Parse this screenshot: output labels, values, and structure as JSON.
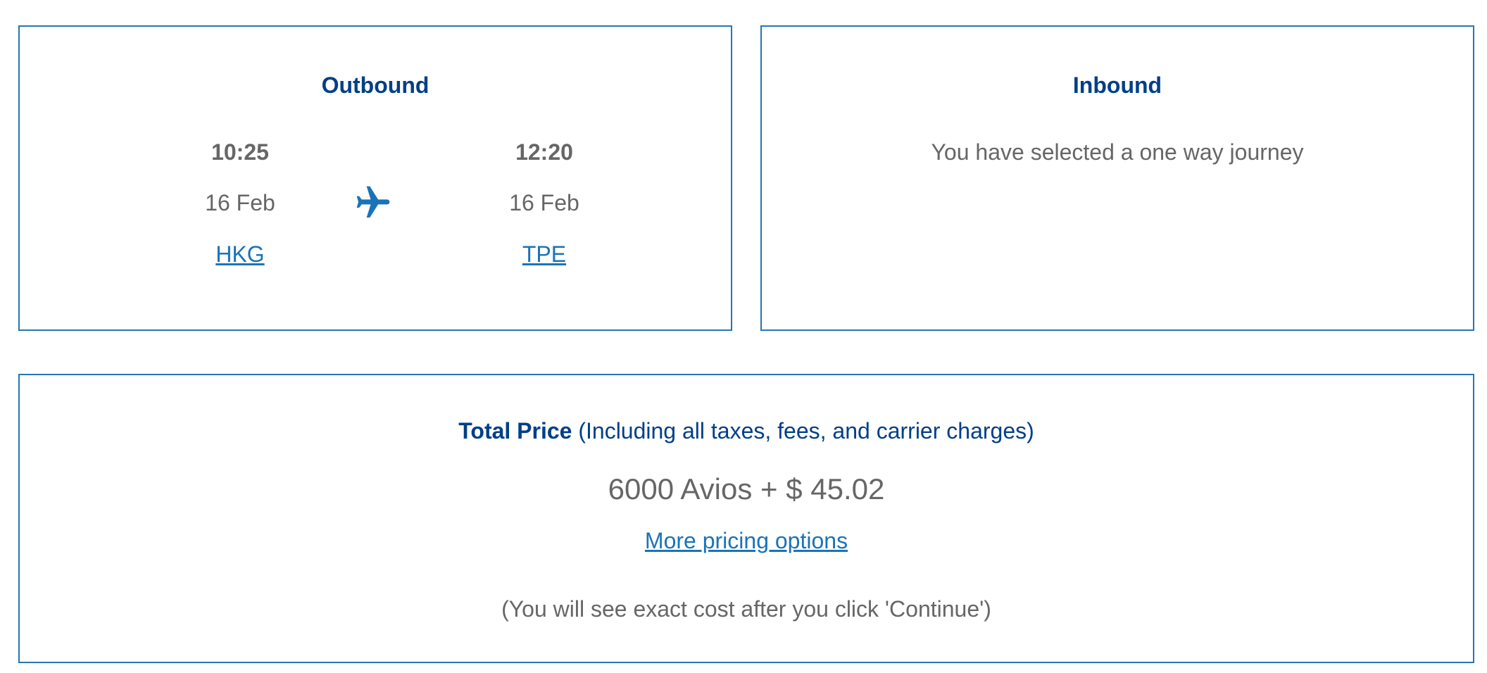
{
  "outbound": {
    "title": "Outbound",
    "departure": {
      "time": "10:25",
      "date": "16 Feb",
      "airport": "HKG"
    },
    "arrival": {
      "time": "12:20",
      "date": "16 Feb",
      "airport": "TPE"
    },
    "icon": "airplane-icon",
    "accent_color": "#1a73b8"
  },
  "inbound": {
    "title": "Inbound",
    "message": "You have selected a one way journey"
  },
  "price": {
    "label_strong": "Total Price",
    "label_detail": " (Including all taxes, fees, and carrier charges)",
    "value": "6000 Avios + $ 45.02",
    "more_options_link": "More pricing options",
    "note": "(You will see exact cost after you click 'Continue')"
  },
  "colors": {
    "border": "#2675b4",
    "heading": "#003f87",
    "link": "#1a73b8",
    "text": "#666666"
  }
}
